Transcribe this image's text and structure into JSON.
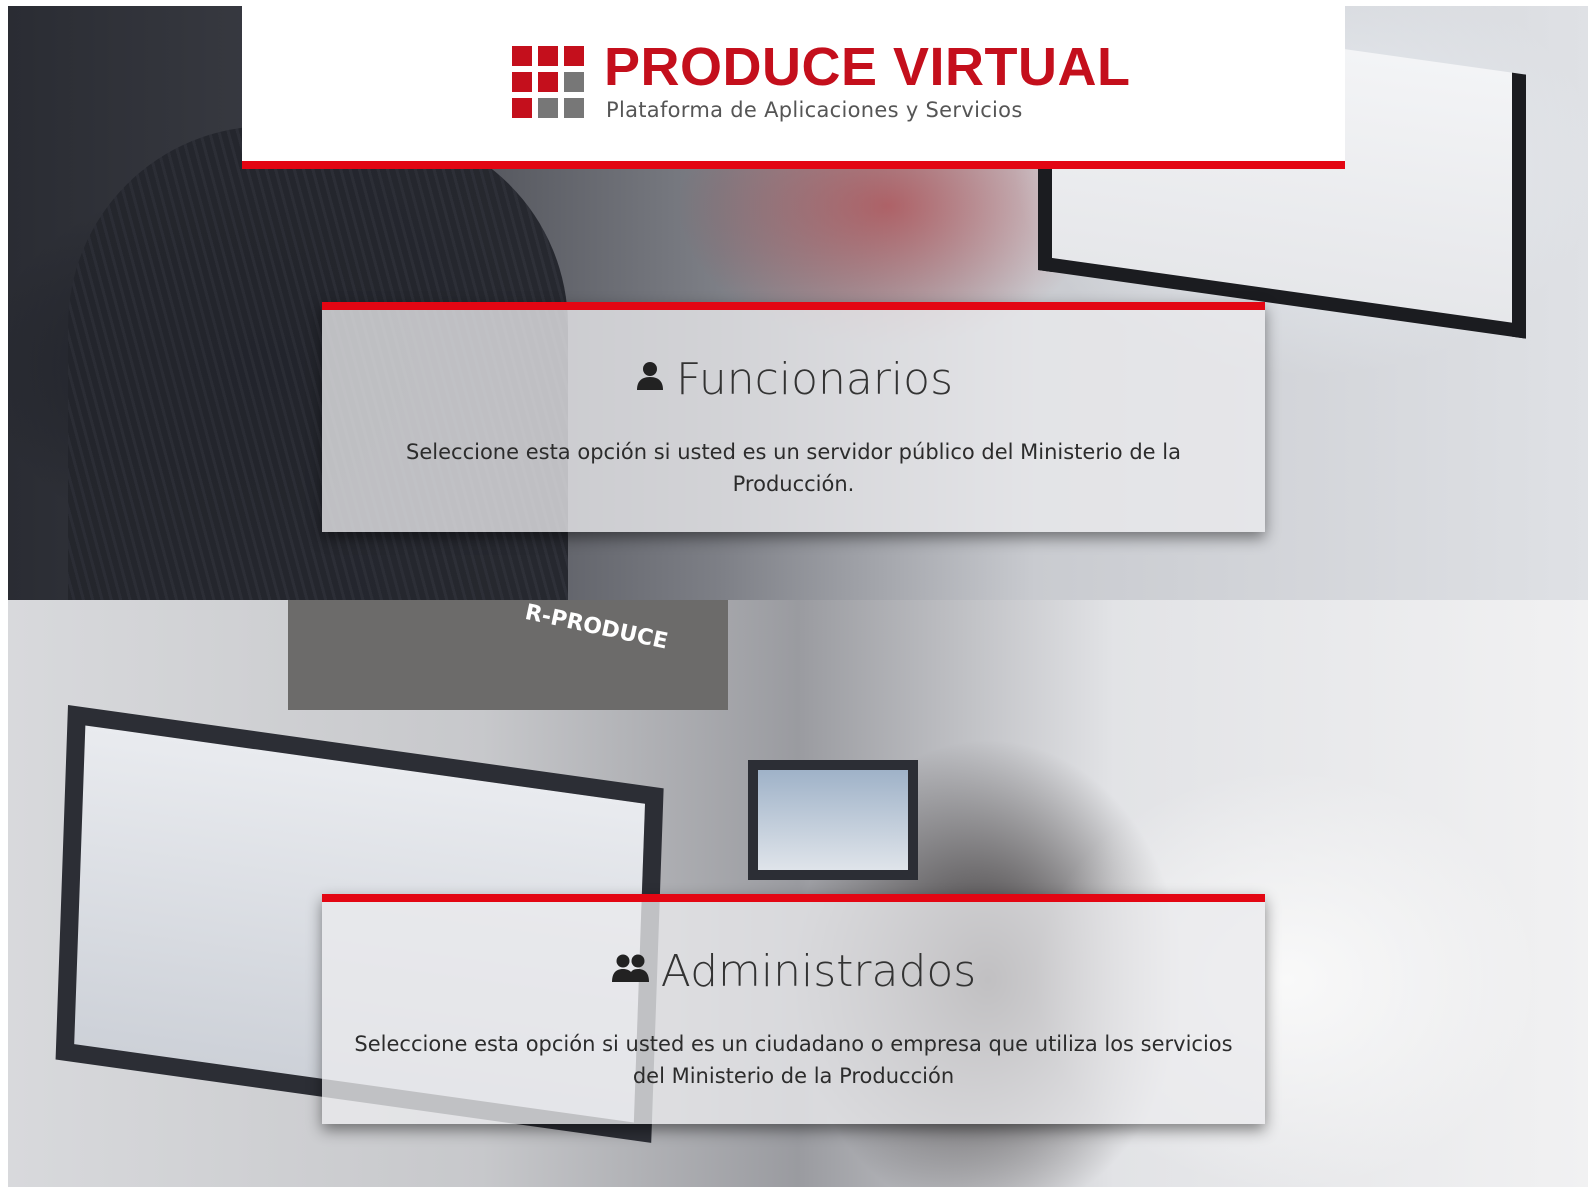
{
  "header": {
    "logo_title": "PRODUCE VIRTUAL",
    "logo_subtitle": "Plataforma de Aplicaciones y Servicios"
  },
  "options": [
    {
      "title": "Funcionarios",
      "icon": "user-icon",
      "description": "Seleccione esta opción si usted es un servidor público del Ministerio de la Producción."
    },
    {
      "title": "Administrados",
      "icon": "users-icon",
      "description": "Seleccione esta opción si usted es un ciudadano o empresa que utiliza los servicios del Ministerio de la Producción"
    }
  ],
  "colors": {
    "accent_red": "#e30613",
    "logo_red": "#c40f1c",
    "logo_gray": "#555555"
  }
}
